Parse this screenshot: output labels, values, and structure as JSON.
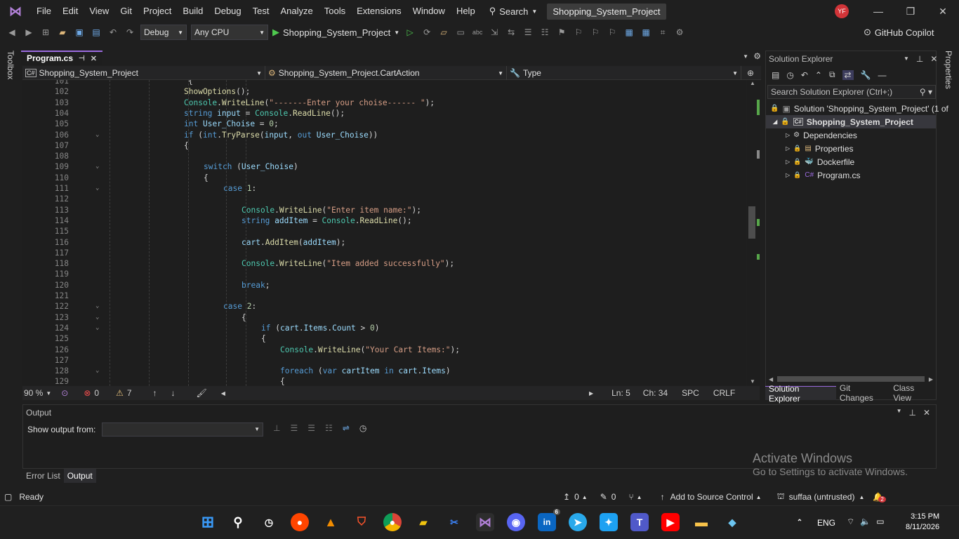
{
  "menu": {
    "items": [
      "File",
      "Edit",
      "View",
      "Git",
      "Project",
      "Build",
      "Debug",
      "Test",
      "Analyze",
      "Tools",
      "Extensions",
      "Window",
      "Help"
    ],
    "search_label": "Search",
    "project_title": "Shopping_System_Project",
    "avatar_initials": "YF"
  },
  "toolbar": {
    "config": "Debug",
    "platform": "Any CPU",
    "run_target": "Shopping_System_Project",
    "copilot": "GitHub Copilot"
  },
  "side": {
    "toolbox": "Toolbox",
    "properties": "Properties"
  },
  "editor": {
    "tab_label": "Program.cs",
    "nav_project": "Shopping_System_Project",
    "nav_class": "Shopping_System_Project.CartAction",
    "nav_member": "Type",
    "lines": [
      {
        "n": "101",
        "fold": false,
        "indent": 136,
        "tokens": [
          {
            "t": "{",
            "c": "pl"
          }
        ]
      },
      {
        "n": "102",
        "fold": false,
        "indent": 130,
        "tokens": [
          {
            "t": "ShowOptions",
            "c": "fn"
          },
          {
            "t": "();",
            "c": "pl"
          }
        ]
      },
      {
        "n": "103",
        "fold": false,
        "indent": 130,
        "tokens": [
          {
            "t": "Console",
            "c": "ty"
          },
          {
            "t": ".",
            "c": "pl"
          },
          {
            "t": "WriteLine",
            "c": "fn"
          },
          {
            "t": "(",
            "c": "pl"
          },
          {
            "t": "\"-------Enter your choise------ \"",
            "c": "st"
          },
          {
            "t": ");",
            "c": "pl"
          }
        ]
      },
      {
        "n": "104",
        "fold": false,
        "indent": 130,
        "tokens": [
          {
            "t": "string",
            "c": "kw"
          },
          {
            "t": " ",
            "c": "pl"
          },
          {
            "t": "input",
            "c": "id"
          },
          {
            "t": " = ",
            "c": "pl"
          },
          {
            "t": "Console",
            "c": "ty"
          },
          {
            "t": ".",
            "c": "pl"
          },
          {
            "t": "ReadLine",
            "c": "fn"
          },
          {
            "t": "();",
            "c": "pl"
          }
        ]
      },
      {
        "n": "105",
        "fold": false,
        "indent": 130,
        "tokens": [
          {
            "t": "int",
            "c": "kw"
          },
          {
            "t": " ",
            "c": "pl"
          },
          {
            "t": "User_Choise",
            "c": "id"
          },
          {
            "t": " = ",
            "c": "pl"
          },
          {
            "t": "0",
            "c": "nu"
          },
          {
            "t": ";",
            "c": "pl"
          }
        ]
      },
      {
        "n": "106",
        "fold": true,
        "indent": 130,
        "tokens": [
          {
            "t": "if",
            "c": "kw"
          },
          {
            "t": " (",
            "c": "pl"
          },
          {
            "t": "int",
            "c": "kw"
          },
          {
            "t": ".",
            "c": "pl"
          },
          {
            "t": "TryParse",
            "c": "fn"
          },
          {
            "t": "(",
            "c": "pl"
          },
          {
            "t": "input",
            "c": "id"
          },
          {
            "t": ", ",
            "c": "pl"
          },
          {
            "t": "out",
            "c": "kw"
          },
          {
            "t": " ",
            "c": "pl"
          },
          {
            "t": "User_Choise",
            "c": "id"
          },
          {
            "t": "))",
            "c": "pl"
          }
        ]
      },
      {
        "n": "107",
        "fold": false,
        "indent": 130,
        "tokens": [
          {
            "t": "{",
            "c": "pl"
          }
        ]
      },
      {
        "n": "108",
        "fold": false,
        "indent": 130,
        "tokens": []
      },
      {
        "n": "109",
        "fold": true,
        "indent": 158,
        "tokens": [
          {
            "t": "switch",
            "c": "kw"
          },
          {
            "t": " (",
            "c": "pl"
          },
          {
            "t": "User_Choise",
            "c": "id"
          },
          {
            "t": ")",
            "c": "pl"
          }
        ]
      },
      {
        "n": "110",
        "fold": false,
        "indent": 158,
        "tokens": [
          {
            "t": "{",
            "c": "pl"
          }
        ]
      },
      {
        "n": "111",
        "fold": true,
        "indent": 186,
        "tokens": [
          {
            "t": "case",
            "c": "kw"
          },
          {
            "t": " ",
            "c": "pl"
          },
          {
            "t": "1",
            "c": "nu"
          },
          {
            "t": ":",
            "c": "pl"
          }
        ]
      },
      {
        "n": "112",
        "fold": false,
        "indent": 186,
        "tokens": []
      },
      {
        "n": "113",
        "fold": false,
        "indent": 212,
        "tokens": [
          {
            "t": "Console",
            "c": "ty"
          },
          {
            "t": ".",
            "c": "pl"
          },
          {
            "t": "WriteLine",
            "c": "fn"
          },
          {
            "t": "(",
            "c": "pl"
          },
          {
            "t": "\"Enter item name:\"",
            "c": "st"
          },
          {
            "t": ");",
            "c": "pl"
          }
        ]
      },
      {
        "n": "114",
        "fold": false,
        "indent": 212,
        "tokens": [
          {
            "t": "string",
            "c": "kw"
          },
          {
            "t": " ",
            "c": "pl"
          },
          {
            "t": "addItem",
            "c": "id"
          },
          {
            "t": " = ",
            "c": "pl"
          },
          {
            "t": "Console",
            "c": "ty"
          },
          {
            "t": ".",
            "c": "pl"
          },
          {
            "t": "ReadLine",
            "c": "fn"
          },
          {
            "t": "();",
            "c": "pl"
          }
        ]
      },
      {
        "n": "115",
        "fold": false,
        "indent": 212,
        "tokens": []
      },
      {
        "n": "116",
        "fold": false,
        "indent": 212,
        "tokens": [
          {
            "t": "cart",
            "c": "id"
          },
          {
            "t": ".",
            "c": "pl"
          },
          {
            "t": "AddItem",
            "c": "fn"
          },
          {
            "t": "(",
            "c": "pl"
          },
          {
            "t": "addItem",
            "c": "id"
          },
          {
            "t": ");",
            "c": "pl"
          }
        ]
      },
      {
        "n": "117",
        "fold": false,
        "indent": 212,
        "tokens": []
      },
      {
        "n": "118",
        "fold": false,
        "indent": 212,
        "tokens": [
          {
            "t": "Console",
            "c": "ty"
          },
          {
            "t": ".",
            "c": "pl"
          },
          {
            "t": "WriteLine",
            "c": "fn"
          },
          {
            "t": "(",
            "c": "pl"
          },
          {
            "t": "\"Item added successfully\"",
            "c": "st"
          },
          {
            "t": ");",
            "c": "pl"
          }
        ]
      },
      {
        "n": "119",
        "fold": false,
        "indent": 212,
        "tokens": []
      },
      {
        "n": "120",
        "fold": false,
        "indent": 212,
        "tokens": [
          {
            "t": "break",
            "c": "kw"
          },
          {
            "t": ";",
            "c": "pl"
          }
        ]
      },
      {
        "n": "121",
        "fold": false,
        "indent": 212,
        "tokens": []
      },
      {
        "n": "122",
        "fold": true,
        "indent": 186,
        "tokens": [
          {
            "t": "case",
            "c": "kw"
          },
          {
            "t": " ",
            "c": "pl"
          },
          {
            "t": "2",
            "c": "nu"
          },
          {
            "t": ":",
            "c": "pl"
          }
        ]
      },
      {
        "n": "123",
        "fold": true,
        "indent": 212,
        "tokens": [
          {
            "t": "{",
            "c": "pl"
          }
        ]
      },
      {
        "n": "124",
        "fold": true,
        "indent": 240,
        "tokens": [
          {
            "t": "if",
            "c": "kw"
          },
          {
            "t": " (",
            "c": "pl"
          },
          {
            "t": "cart",
            "c": "id"
          },
          {
            "t": ".",
            "c": "pl"
          },
          {
            "t": "Items",
            "c": "id"
          },
          {
            "t": ".",
            "c": "pl"
          },
          {
            "t": "Count",
            "c": "id"
          },
          {
            "t": " > ",
            "c": "pl"
          },
          {
            "t": "0",
            "c": "nu"
          },
          {
            "t": ")",
            "c": "pl"
          }
        ]
      },
      {
        "n": "125",
        "fold": false,
        "indent": 240,
        "tokens": [
          {
            "t": "{",
            "c": "pl"
          }
        ]
      },
      {
        "n": "126",
        "fold": false,
        "indent": 267,
        "tokens": [
          {
            "t": "Console",
            "c": "ty"
          },
          {
            "t": ".",
            "c": "pl"
          },
          {
            "t": "WriteLine",
            "c": "fn"
          },
          {
            "t": "(",
            "c": "pl"
          },
          {
            "t": "\"Your Cart Items:\"",
            "c": "st"
          },
          {
            "t": ");",
            "c": "pl"
          }
        ]
      },
      {
        "n": "127",
        "fold": false,
        "indent": 267,
        "tokens": []
      },
      {
        "n": "128",
        "fold": true,
        "indent": 267,
        "tokens": [
          {
            "t": "foreach",
            "c": "kw"
          },
          {
            "t": " (",
            "c": "pl"
          },
          {
            "t": "var",
            "c": "kw"
          },
          {
            "t": " ",
            "c": "pl"
          },
          {
            "t": "cartItem",
            "c": "id"
          },
          {
            "t": " ",
            "c": "pl"
          },
          {
            "t": "in",
            "c": "kw"
          },
          {
            "t": " ",
            "c": "pl"
          },
          {
            "t": "cart",
            "c": "id"
          },
          {
            "t": ".",
            "c": "pl"
          },
          {
            "t": "Items",
            "c": "id"
          },
          {
            "t": ")",
            "c": "pl"
          }
        ]
      },
      {
        "n": "129",
        "fold": false,
        "indent": 267,
        "tokens": [
          {
            "t": "{",
            "c": "pl"
          }
        ]
      }
    ],
    "zoom": "90 %",
    "errors": "0",
    "warnings": "7",
    "ln": "Ln: 5",
    "ch": "Ch: 34",
    "spc": "SPC",
    "crlf": "CRLF"
  },
  "solution_explorer": {
    "title": "Solution Explorer",
    "search_placeholder": "Search Solution Explorer (Ctrl+;)",
    "solution": "Solution 'Shopping_System_Project' (1 of",
    "project": "Shopping_System_Project",
    "items": [
      "Dependencies",
      "Properties",
      "Dockerfile",
      "Program.cs"
    ],
    "tabs": [
      "Solution Explorer",
      "Git Changes",
      "Class View"
    ]
  },
  "output": {
    "title": "Output",
    "show_from_label": "Show output from:",
    "tabs": [
      "Error List",
      "Output"
    ]
  },
  "watermark": {
    "line1": "Activate Windows",
    "line2": "Go to Settings to activate Windows."
  },
  "statusbar": {
    "ready": "Ready",
    "pushes": "0",
    "edits": "0",
    "source_control": "Add to Source Control",
    "repo": "suffaa (untrusted)",
    "notif": "2"
  },
  "taskbar": {
    "lang": "ENG",
    "time": "3:15 PM",
    "date": "8/11/2026",
    "linkedin_badge": "6"
  },
  "colors": {
    "accent": "#9b6bdf",
    "string": "#d69d85",
    "keyword": "#569cd6",
    "type": "#4ec9b0",
    "method": "#dcdcaa",
    "identifier": "#9cdcfe"
  }
}
